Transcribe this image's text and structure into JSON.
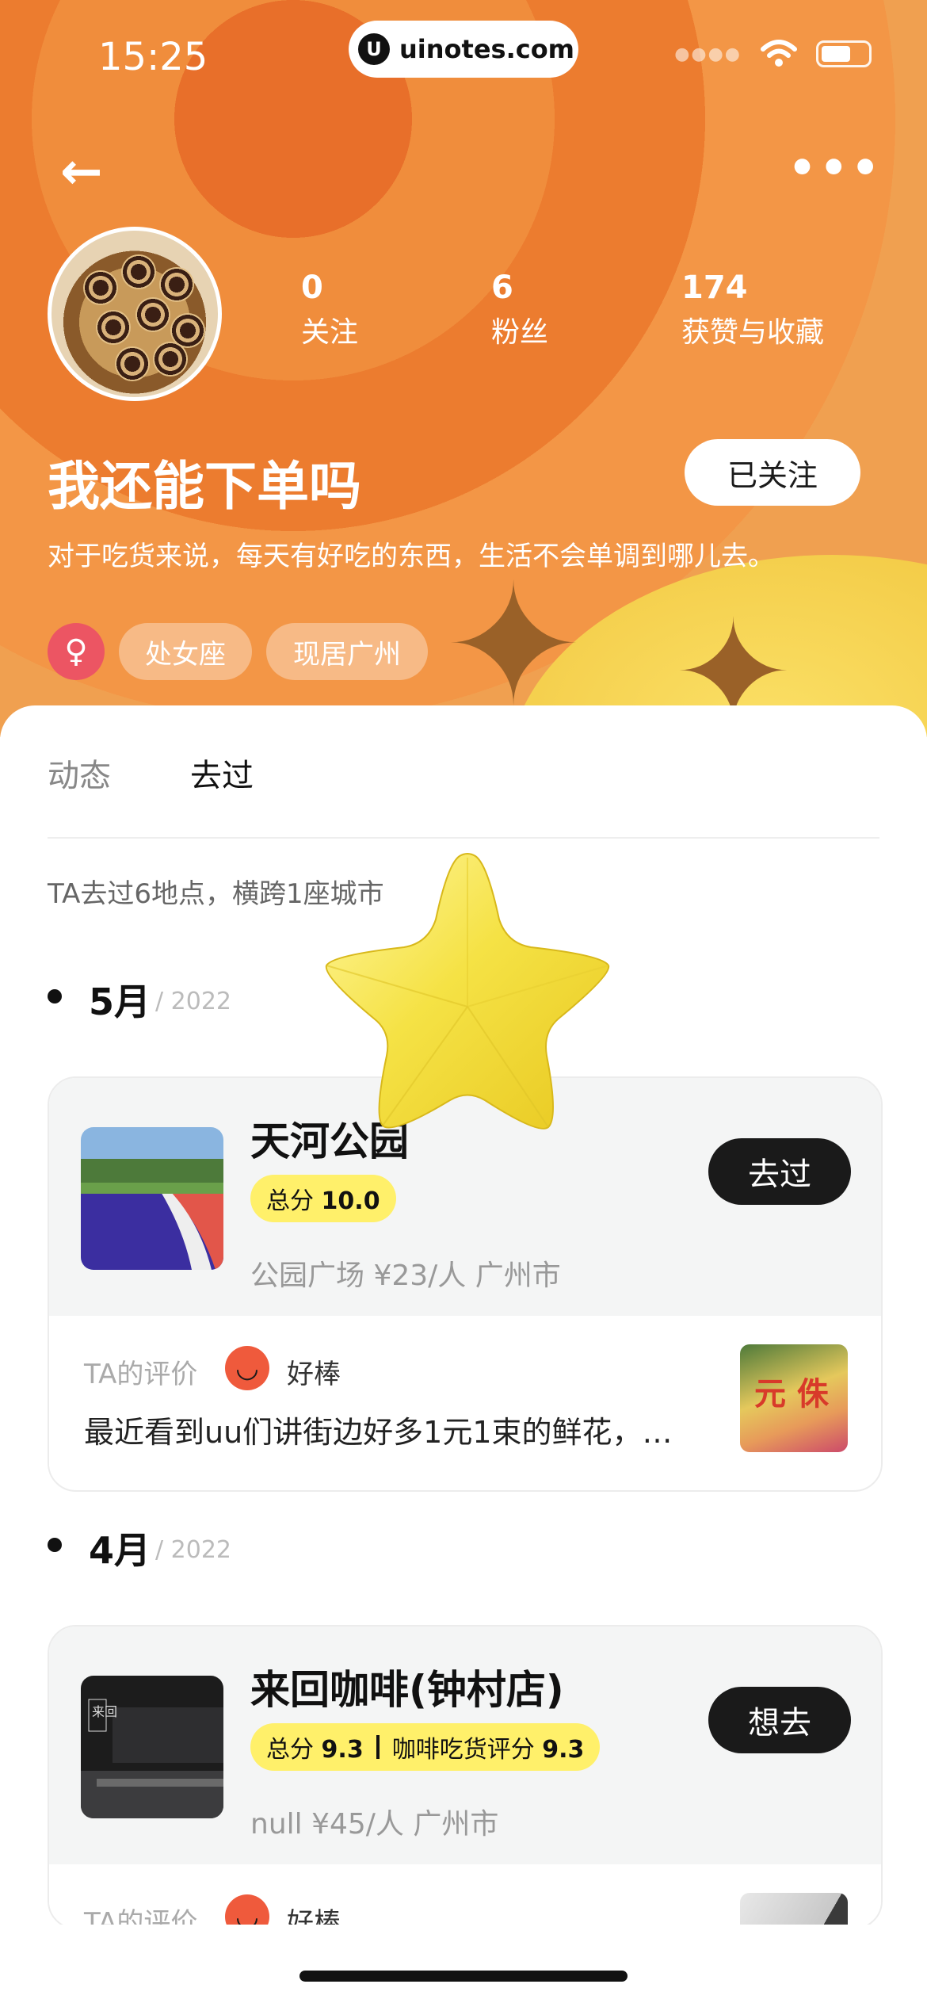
{
  "status_bar": {
    "time": "15:25",
    "url": "uinotes.com",
    "url_logo": "U"
  },
  "nav": {
    "back_icon": "←",
    "more_icon": "•••"
  },
  "profile": {
    "name": "我还能下单吗",
    "bio": "对于吃货来说，每天有好吃的东西，生活不会单调到哪儿去。",
    "follow_button": "已关注",
    "gender_icon": "♀",
    "tags": [
      "处女座",
      "现居广州"
    ],
    "stats": [
      {
        "value": "0",
        "label": "关注"
      },
      {
        "value": "6",
        "label": "粉丝"
      },
      {
        "value": "174",
        "label": "获赞与收藏"
      }
    ]
  },
  "tabs": [
    {
      "label": "动态"
    },
    {
      "label": "去过"
    }
  ],
  "summary": "TA去过6地点，横跨1座城市",
  "months": [
    {
      "month": "5月",
      "year": "/ 2022"
    },
    {
      "month": "4月",
      "year": "/ 2022"
    }
  ],
  "places": [
    {
      "title": "天河公园",
      "score_label": "总分",
      "score_value": "10.0",
      "meta": "公园广场   ¥23/人   广州市",
      "button": "去过",
      "review_label": "TA的评价",
      "review_rating": "好棒",
      "review_text": "最近看到uu们讲街边好多1元1束的鲜花，…",
      "thumb_text": "元 侏"
    },
    {
      "title": "来回咖啡(钟村店)",
      "score_label": "总分",
      "score_value": "9.3",
      "score2_label": "咖啡吃货评分",
      "score2_value": "9.3",
      "meta": "null   ¥45/人   广州市",
      "button": "想去",
      "review_label": "TA的评价",
      "review_rating": "好棒",
      "cafe_sign": "来回"
    }
  ],
  "colors": {
    "accent_orange": "#f08d3c",
    "score_yellow": "#fff06a",
    "gender_pink": "#ec5563",
    "button_dark": "#1a1a1a"
  }
}
